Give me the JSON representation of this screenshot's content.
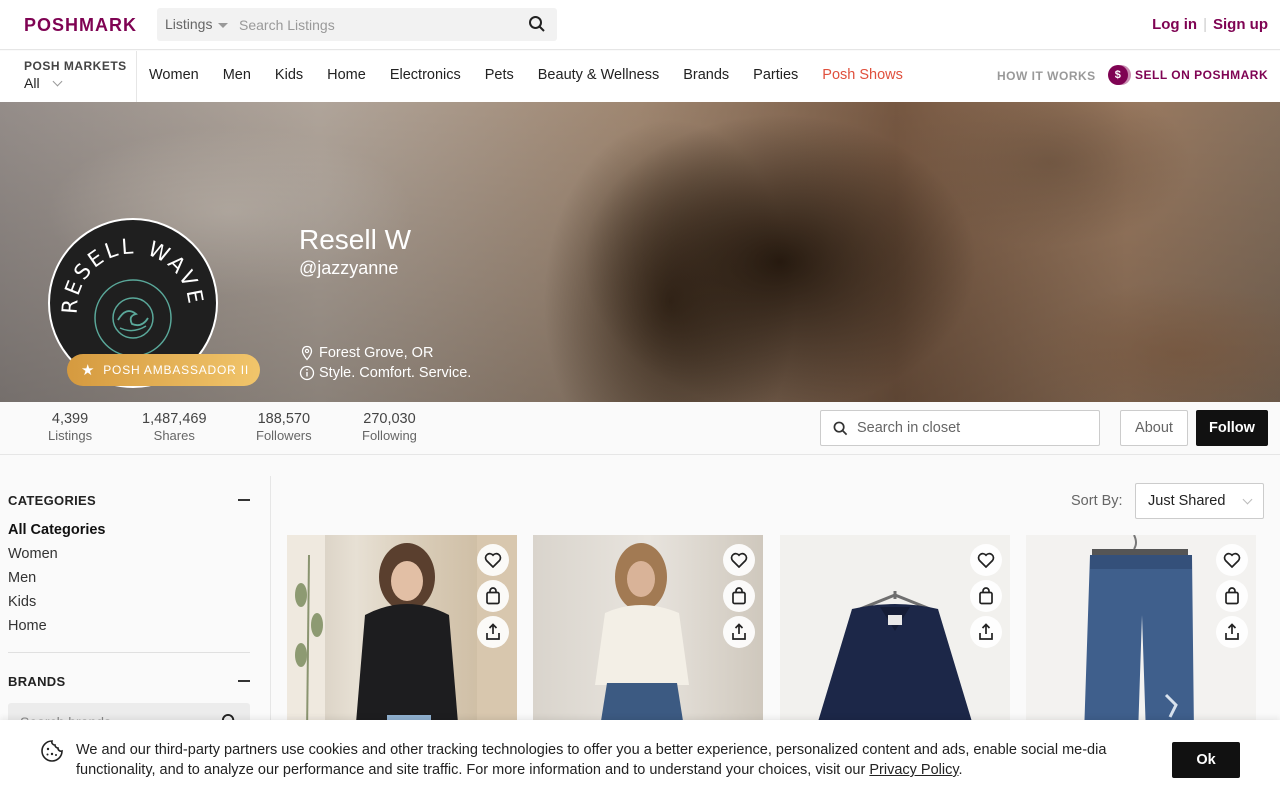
{
  "header": {
    "logo": "POSHMARK",
    "search_dropdown": "Listings",
    "search_placeholder": "Search Listings",
    "login": "Log in",
    "signup": "Sign up"
  },
  "nav": {
    "markets_label": "POSH MARKETS",
    "markets_value": "All",
    "links": [
      "Women",
      "Men",
      "Kids",
      "Home",
      "Electronics",
      "Pets",
      "Beauty & Wellness",
      "Brands",
      "Parties",
      "Posh Shows"
    ],
    "how_it_works": "HOW IT WORKS",
    "sell": "SELL ON POSHMARK",
    "sell_icon": "$"
  },
  "profile": {
    "name": "Resell W",
    "handle": "@jazzyanne",
    "avatar_text": "RESELL WAVE",
    "badge": "POSH AMBASSADOR II",
    "location": "Forest Grove, OR",
    "bio": "Style. Comfort. Service."
  },
  "stats": [
    {
      "value": "4,399",
      "label": "Listings"
    },
    {
      "value": "1,487,469",
      "label": "Shares"
    },
    {
      "value": "188,570",
      "label": "Followers"
    },
    {
      "value": "270,030",
      "label": "Following"
    }
  ],
  "closet": {
    "search_placeholder": "Search in closet",
    "about": "About",
    "follow": "Follow"
  },
  "sidebar": {
    "categories_title": "CATEGORIES",
    "categories": [
      "All Categories",
      "Women",
      "Men",
      "Kids",
      "Home"
    ],
    "brands_title": "BRANDS",
    "brands_placeholder": "Search brands..."
  },
  "sort": {
    "label": "Sort By:",
    "value": "Just Shared"
  },
  "cookie": {
    "text": "We and our third-party partners use cookies and other tracking technologies to offer you a better experience, personalized content and ads, enable social me-dia functionality, and to analyze our performance and site traffic. For more information and to understand your choices, visit our ",
    "link": "Privacy Policy",
    "ok": "Ok"
  },
  "colors": {
    "brand": "#7f0353",
    "accent_red": "#e0503d",
    "badge_gold": "#e6b55a"
  }
}
